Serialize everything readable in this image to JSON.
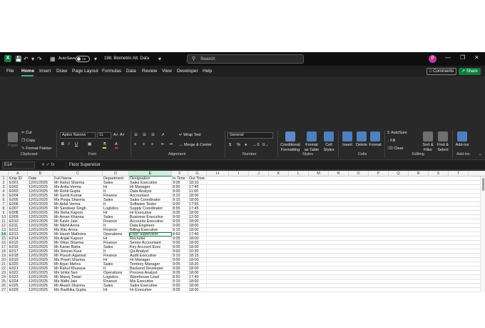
{
  "titlebar": {
    "logo": "X",
    "autosave_label": "AutoSave",
    "autosave_state": "Off",
    "document_title": "198. Biometric Att. Data",
    "search_placeholder": "Search",
    "avatar_initial": "P"
  },
  "menu": {
    "items": [
      "File",
      "Home",
      "Insert",
      "Draw",
      "Page Layout",
      "Formulas",
      "Data",
      "Review",
      "View",
      "Developer",
      "Help"
    ],
    "active": "Home",
    "comments_label": "Comments",
    "share_label": "Share"
  },
  "ribbon": {
    "clipboard": {
      "paste": "Paste",
      "cut": "Cut",
      "copy": "Copy",
      "format_painter": "Format Painter",
      "group": "Clipboard"
    },
    "font": {
      "name": "Aptos Narrow",
      "size": "11",
      "group": "Font"
    },
    "alignment": {
      "wrap": "Wrap Text",
      "merge": "Merge & Center",
      "group": "Alignment"
    },
    "number": {
      "format": "General",
      "group": "Number"
    },
    "styles": {
      "conditional": "Conditional Formatting",
      "format_table": "Format as Table",
      "cell_styles": "Cell Styles",
      "group": "Styles"
    },
    "cells": {
      "insert": "Insert",
      "delete": "Delete",
      "format": "Format",
      "group": "Cells"
    },
    "editing": {
      "autosum": "AutoSum",
      "fill": "Fill",
      "clear": "Clear",
      "sort_filter": "Sort & Filter",
      "find_select": "Find & Select",
      "group": "Editing"
    },
    "addins": {
      "label": "Add-ins",
      "group": "Add-ins"
    }
  },
  "formula_bar": {
    "name_box": "E14",
    "formula": "Floor Supervisor"
  },
  "sheet": {
    "column_letters": [
      "A",
      "B",
      "C",
      "D",
      "E",
      "F",
      "G",
      "H",
      "I",
      "J",
      "K",
      "L",
      "M",
      "N",
      "O",
      "P",
      "Q",
      "R",
      "S",
      "T"
    ],
    "selected_column": "E",
    "selected_row": 14,
    "headers": [
      "Emp ID",
      "Date",
      "Full Name",
      "Department",
      "Designation",
      "In Time",
      "Out Time"
    ],
    "rows": [
      [
        "E001",
        "12/01/2025",
        "Mr Rahul Sharma",
        "Sales",
        "Sales Executive",
        "9:05",
        "18:10"
      ],
      [
        "E002",
        "12/01/2025",
        "Ms Anita Verma",
        "Hr",
        "Hr Manager",
        "8:55",
        "17:45"
      ],
      [
        "E003",
        "12/01/2025",
        "Mr Rohit Gupta",
        "It",
        "Data Analyst",
        "9:00",
        "11:00"
      ],
      [
        "E004",
        "12/01/2025",
        "Mr Sumit Kumar",
        "Finance",
        "Accountant",
        "9:10",
        "18:00"
      ],
      [
        "E005",
        "12/01/2025",
        "Ms Pooja Sharma",
        "Sales",
        "Sales Coordinator",
        "9:15",
        "18:00"
      ],
      [
        "E006",
        "12/01/2025",
        "Mr Ankit Verma",
        "It",
        "Software Tester",
        "9:00",
        "17:55"
      ],
      [
        "E007",
        "12/01/2025",
        "Mr Sandeep Singh",
        "Logistics",
        "Supply Coordinator",
        "8:55",
        "17:45"
      ],
      [
        "E008",
        "12/01/2025",
        "Ms Neha Kapoor",
        "Hr",
        "Hr Executive",
        "9:05",
        "18:00"
      ],
      [
        "E009",
        "12/01/2025",
        "Mr Aman Khanna",
        "Sales",
        "Business Executive",
        "9:00",
        "12:00"
      ],
      [
        "E010",
        "12/01/2025",
        "Mr Kavin Jain",
        "Finance",
        "Accounts Executive",
        "9:05",
        "18:00"
      ],
      [
        "E011",
        "12/01/2025",
        "Mr Nikhil Arora",
        "It",
        "Data Engineer",
        "9:00",
        "18:00"
      ],
      [
        "E012",
        "12/01/2025",
        "Ms Ritu Arora",
        "Finance",
        "Billing Executive",
        "9:15",
        "18:00"
      ],
      [
        "E013",
        "12/01/2025",
        "Mr Harsh Malhotra",
        "Operations",
        "Floor Supervisor",
        "8:50",
        "17:40"
      ],
      [
        "E014",
        "12/01/2025",
        "Ms Anjali Kapoor",
        "Hr",
        "Recruiter",
        "9:05",
        "18:00"
      ],
      [
        "E015",
        "12/01/2025",
        "Mr Vikas Sharma",
        "Finance",
        "Senior Accountant",
        "9:00",
        "18:00"
      ],
      [
        "E016",
        "12/01/2025",
        "Mr Karan Batra",
        "Sales",
        "Key Account Exec",
        "9:05",
        "18:00"
      ],
      [
        "E017",
        "12/01/2025",
        "Ms Simran Kaur",
        "It",
        "Qa Analyst",
        "9:00",
        "10:30"
      ],
      [
        "E018",
        "12/01/2025",
        "Mr Piyush Agarwal",
        "Finance",
        "Audit Executive",
        "9:10",
        "18:15"
      ],
      [
        "E019",
        "12/01/2025",
        "Ms Preeti Sharma",
        "Hr",
        "Hr Manager",
        "9:00",
        "18:00"
      ],
      [
        "E020",
        "12/01/2025",
        "Mr Arjun Mehra",
        "Sales",
        "Territory Manager",
        "9:05",
        "18:20"
      ],
      [
        "E021",
        "12/01/2025",
        "Mr Rahul Khurana",
        "It",
        "Backend Developer",
        "9:00",
        "18:00"
      ],
      [
        "E022",
        "12/01/2025",
        "Ms Ishita Sen",
        "Operations",
        "Process Analyst",
        "9:05",
        "18:00"
      ],
      [
        "E023",
        "12/01/2025",
        "Mr Manoj Tiwari",
        "Logistics",
        "Warehouse Lead",
        "8:50",
        "17:40"
      ],
      [
        "E024",
        "12/01/2025",
        "Ms Nidhi Jain",
        "Finance",
        "Mis Executive",
        "9:10",
        "18:00"
      ],
      [
        "E025",
        "12/01/2025",
        "Mr Akash Sharma",
        "Sales",
        "Sales Executive",
        "9:00",
        "18:00"
      ],
      [
        "E026",
        "12/01/2025",
        "Ms Radhika Gupta",
        "Hr",
        "Hr Executive",
        "9:05",
        "18:00"
      ]
    ]
  },
  "colors": {
    "accent": "#107c41",
    "dark_bg": "#1f1f1f",
    "ribbon_bg": "#292929"
  }
}
